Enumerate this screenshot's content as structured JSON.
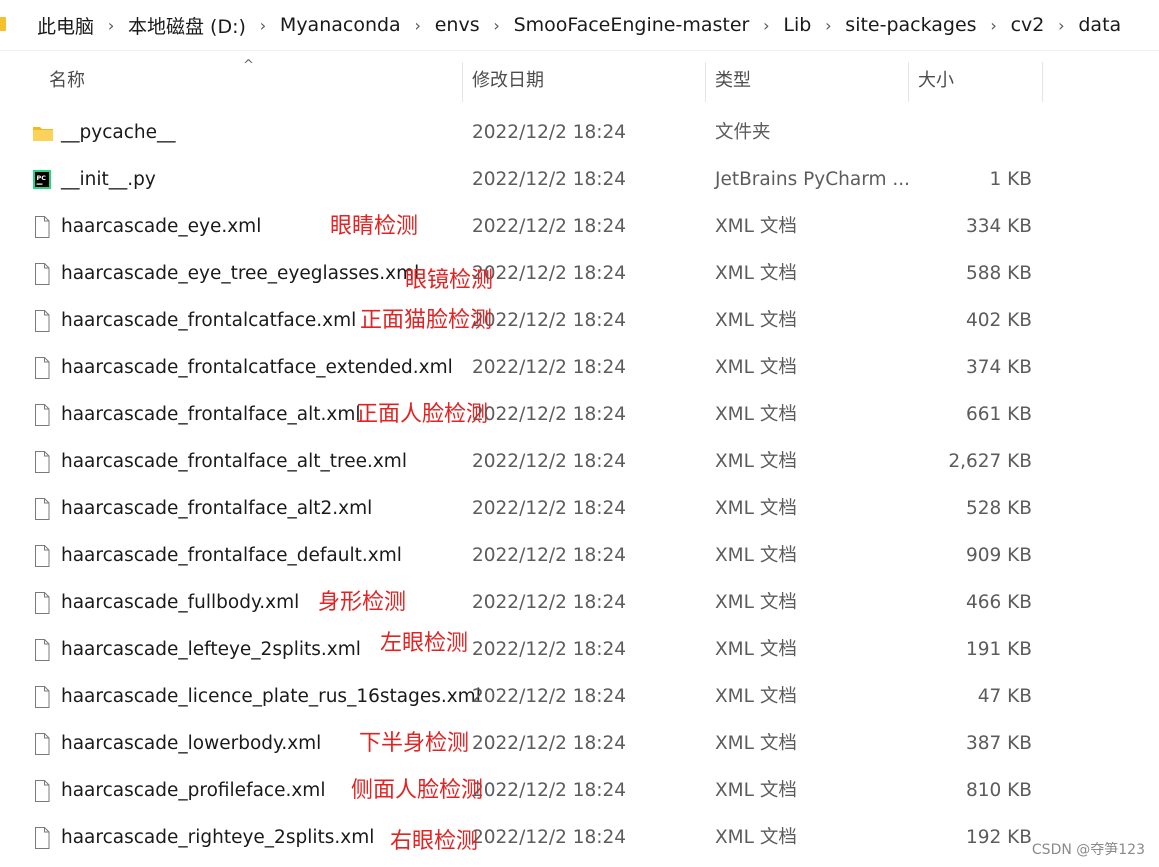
{
  "breadcrumb": [
    "此电脑",
    "本地磁盘 (D:)",
    "Myanaconda",
    "envs",
    "SmooFaceEngine-master",
    "Lib",
    "site-packages",
    "cv2",
    "data"
  ],
  "breadcrumb_separator": "›",
  "columns": {
    "name": "名称",
    "date": "修改日期",
    "type": "类型",
    "size": "大小"
  },
  "sort_indicator": "^",
  "files": [
    {
      "name": "__pycache__",
      "date": "2022/12/2 18:24",
      "type": "文件夹",
      "size": "",
      "icon": "folder-icon",
      "note": ""
    },
    {
      "name": "__init__.py",
      "date": "2022/12/2 18:24",
      "type": "JetBrains PyCharm ...",
      "size": "1 KB",
      "icon": "pycharm-file-icon",
      "note": ""
    },
    {
      "name": "haarcascade_eye.xml",
      "date": "2022/12/2 18:24",
      "type": "XML 文档",
      "size": "334 KB",
      "icon": "file-icon",
      "note": "眼睛检测"
    },
    {
      "name": "haarcascade_eye_tree_eyeglasses.xml",
      "date": "2022/12/2 18:24",
      "type": "XML 文档",
      "size": "588 KB",
      "icon": "file-icon",
      "note": "眼镜检测"
    },
    {
      "name": "haarcascade_frontalcatface.xml",
      "date": "2022/12/2 18:24",
      "type": "XML 文档",
      "size": "402 KB",
      "icon": "file-icon",
      "note": "正面猫脸检测"
    },
    {
      "name": "haarcascade_frontalcatface_extended.xml",
      "date": "2022/12/2 18:24",
      "type": "XML 文档",
      "size": "374 KB",
      "icon": "file-icon",
      "note": ""
    },
    {
      "name": "haarcascade_frontalface_alt.xml",
      "date": "2022/12/2 18:24",
      "type": "XML 文档",
      "size": "661 KB",
      "icon": "file-icon",
      "note": "正面人脸检测"
    },
    {
      "name": "haarcascade_frontalface_alt_tree.xml",
      "date": "2022/12/2 18:24",
      "type": "XML 文档",
      "size": "2,627 KB",
      "icon": "file-icon",
      "note": ""
    },
    {
      "name": "haarcascade_frontalface_alt2.xml",
      "date": "2022/12/2 18:24",
      "type": "XML 文档",
      "size": "528 KB",
      "icon": "file-icon",
      "note": ""
    },
    {
      "name": "haarcascade_frontalface_default.xml",
      "date": "2022/12/2 18:24",
      "type": "XML 文档",
      "size": "909 KB",
      "icon": "file-icon",
      "note": ""
    },
    {
      "name": "haarcascade_fullbody.xml",
      "date": "2022/12/2 18:24",
      "type": "XML 文档",
      "size": "466 KB",
      "icon": "file-icon",
      "note": "身形检测"
    },
    {
      "name": "haarcascade_lefteye_2splits.xml",
      "date": "2022/12/2 18:24",
      "type": "XML 文档",
      "size": "191 KB",
      "icon": "file-icon",
      "note": "左眼检测"
    },
    {
      "name": "haarcascade_licence_plate_rus_16stages.xml",
      "date": "2022/12/2 18:24",
      "type": "XML 文档",
      "size": "47 KB",
      "icon": "file-icon",
      "note": ""
    },
    {
      "name": "haarcascade_lowerbody.xml",
      "date": "2022/12/2 18:24",
      "type": "XML 文档",
      "size": "387 KB",
      "icon": "file-icon",
      "note": "下半身检测"
    },
    {
      "name": "haarcascade_profileface.xml",
      "date": "2022/12/2 18:24",
      "type": "XML 文档",
      "size": "810 KB",
      "icon": "file-icon",
      "note": "侧面人脸检测"
    },
    {
      "name": "haarcascade_righteye_2splits.xml",
      "date": "2022/12/2 18:24",
      "type": "XML 文档",
      "size": "192 KB",
      "icon": "file-icon",
      "note": "右眼检测"
    }
  ],
  "annotation_color": "#e32222",
  "watermark": "CSDN @夺笋123"
}
